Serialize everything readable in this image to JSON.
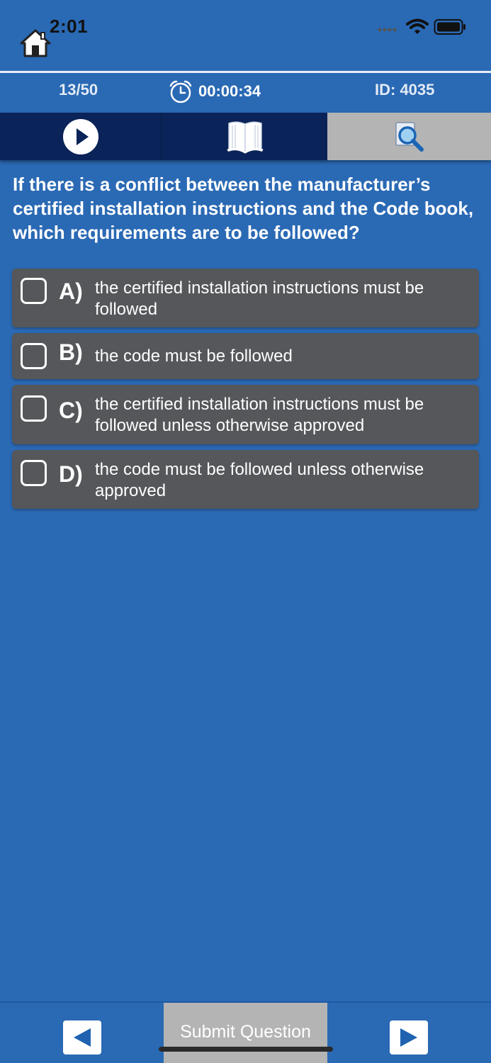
{
  "status_bar": {
    "time": "2:01",
    "icons": [
      "home-icon",
      "signal-dots-icon",
      "wifi-icon",
      "battery-icon"
    ]
  },
  "info_row": {
    "progress": "13/50",
    "timer": "00:00:34",
    "question_id": "ID: 4035",
    "timer_icon": "alarm-clock-icon"
  },
  "tabs": [
    {
      "name": "play",
      "icon": "play-icon",
      "selected": false
    },
    {
      "name": "book",
      "icon": "book-icon",
      "selected": false
    },
    {
      "name": "search",
      "icon": "magnifier-icon",
      "selected": true
    }
  ],
  "question": {
    "text": "If there is a conflict between the manufacturer’s certified installation instructions and the Code book, which  requirements are to be followed?"
  },
  "options": [
    {
      "letter": "A)",
      "text": "the certified installation instructions must be followed",
      "checked": false
    },
    {
      "letter": "B)",
      "text": "the code must be followed",
      "checked": false
    },
    {
      "letter": "C)",
      "text": "the certified installation instructions must be followed unless otherwise approved",
      "checked": false
    },
    {
      "letter": "D)",
      "text": "the code must be followed unless otherwise approved",
      "checked": false
    }
  ],
  "footer": {
    "submit_label": "Submit Question",
    "prev_icon": "left-arrow-icon",
    "next_icon": "right-arrow-icon"
  },
  "colors": {
    "background": "#2a69b4",
    "tab_bar": "#0a2358",
    "tab_selected": "#b4b4b4",
    "option_card": "#55575a"
  }
}
